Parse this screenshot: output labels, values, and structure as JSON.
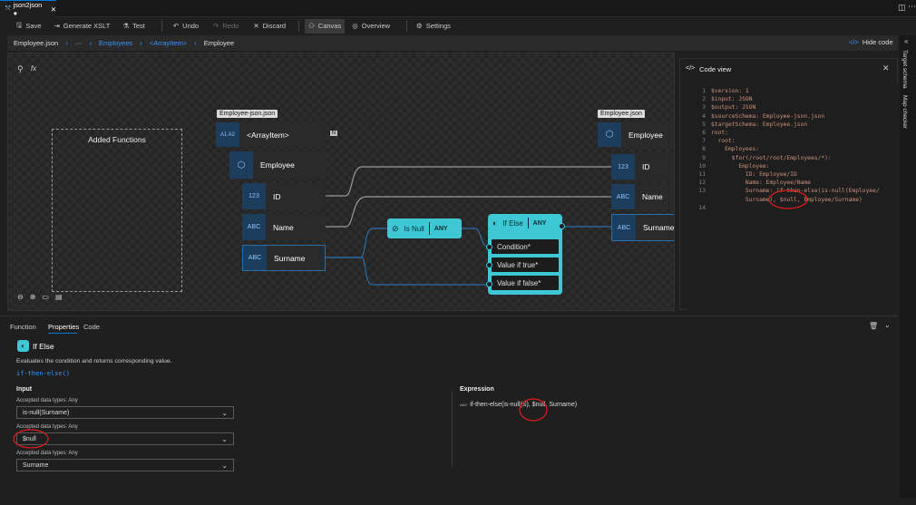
{
  "tab": {
    "title": "json2json ●"
  },
  "toolbar": {
    "save": "Save",
    "generate_xslt": "Generate XSLT",
    "test": "Test",
    "undo": "Undo",
    "redo": "Redo",
    "discard": "Discard",
    "canvas": "Canvas",
    "overview": "Overview",
    "settings": "Settings"
  },
  "breadcrumb": {
    "file": "Employee.json",
    "ellipsis": "···",
    "employees": "Employees",
    "arrayitem": "<ArrayItem>",
    "employee": "Employee",
    "hide_code": "Hide code"
  },
  "canvas": {
    "fx": "fx",
    "added_functions": "Added Functions",
    "source_label": "Employee-json.json",
    "target_label": "Employee.json",
    "source_nodes": {
      "arrayitem": {
        "icon": "A1 A2",
        "label": "<ArrayItem>",
        "badge": "N"
      },
      "employee": {
        "label": "Employee"
      },
      "id": {
        "icon": "123",
        "label": "ID"
      },
      "name": {
        "icon": "ABC",
        "label": "Name"
      },
      "surname": {
        "icon": "ABC",
        "label": "Surname"
      }
    },
    "target_nodes": {
      "employee": {
        "label": "Employee"
      },
      "id": {
        "icon": "123",
        "label": "ID"
      },
      "name": {
        "icon": "ABC",
        "label": "Name"
      },
      "surname": {
        "icon": "ABC",
        "label": "Surname"
      }
    },
    "isnull": {
      "label": "Is Null",
      "type": "ANY"
    },
    "ifelse": {
      "label": "If Else",
      "type": "ANY",
      "condition": "Condition*",
      "if_true": "Value if true*",
      "if_false": "Value if false*"
    }
  },
  "codeview": {
    "title": "Code view",
    "lines": [
      {
        "n": "1",
        "text": "$version: 1"
      },
      {
        "n": "2",
        "text": "$input: JSON"
      },
      {
        "n": "3",
        "text": "$output: JSON"
      },
      {
        "n": "4",
        "text": "$sourceSchema: Employee-json.json"
      },
      {
        "n": "5",
        "text": "$targetSchema: Employee.json"
      },
      {
        "n": "6",
        "text": "root:"
      },
      {
        "n": "7",
        "text": "  root:"
      },
      {
        "n": "8",
        "text": "    Employees:"
      },
      {
        "n": "9",
        "text": "      $for(/root/root/Employees/*):"
      },
      {
        "n": "10",
        "text": "        Employee:"
      },
      {
        "n": "11",
        "text": "          ID: Employee/ID"
      },
      {
        "n": "12",
        "text": "          Name: Employee/Name"
      },
      {
        "n": "13",
        "text": "          Surname: if-then-else(is-null(Employee/"
      },
      {
        "n": "",
        "text": "          Surname), $null, Employee/Surname)"
      },
      {
        "n": "14",
        "text": ""
      }
    ]
  },
  "rightrail": {
    "target_schema": "Target schema",
    "map_checker": "Map checker"
  },
  "panel": {
    "tabs": {
      "function": "Function",
      "properties": "Properties",
      "code": "Code"
    },
    "fn_title": "If Else",
    "description": "Evaluates the condition and returns corresponding value.",
    "signature": "if-then-else()",
    "input_heading": "Input",
    "inputs": [
      {
        "accepted": "Accepted data types: Any",
        "value": "is-null(Surname)"
      },
      {
        "accepted": "Accepted data types: Any",
        "value": "$null"
      },
      {
        "accepted": "Accepted data types: Any",
        "value": "Surname"
      }
    ],
    "expression_heading": "Expression",
    "expression_prefix": "ANY",
    "expression": "if-then-else(is-null(S), $null, Surname)"
  },
  "colors": {
    "accent": "#0078d4",
    "function_node": "#3ec8d6",
    "annotation": "#e01b1b"
  }
}
